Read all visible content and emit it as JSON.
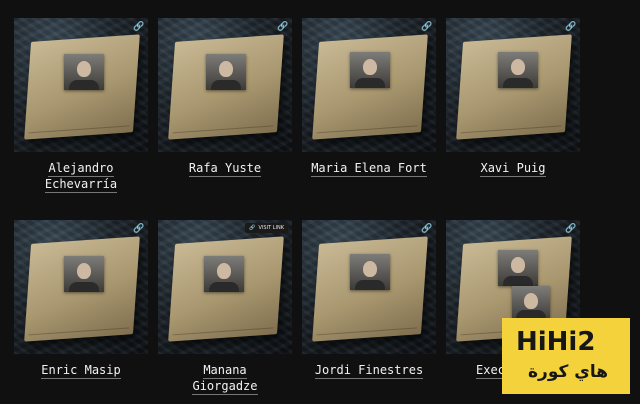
{
  "cards": [
    {
      "name_line1": "Alejandro",
      "name_line2": "Echevarría",
      "link_icon": "link-icon"
    },
    {
      "name_line1": "Rafa Yuste",
      "name_line2": "",
      "link_icon": "link-icon"
    },
    {
      "name_line1": "Maria Elena Fort",
      "name_line2": "",
      "link_icon": "link-icon"
    },
    {
      "name_line1": "Xavi Puig",
      "name_line2": "",
      "link_icon": "link-icon"
    },
    {
      "name_line1": "Enric Masip",
      "name_line2": "",
      "link_icon": "link-icon"
    },
    {
      "name_line1": "Manana",
      "name_line2": "Giorgadze",
      "visit_label": "VISIT LINK"
    },
    {
      "name_line1": "Jordi Finestres",
      "name_line2": "",
      "link_icon": "link-icon"
    },
    {
      "name_line1": "Exec",
      "name_line2": "",
      "link_icon": "link-icon"
    }
  ],
  "watermark": {
    "main": "HiHi2",
    "sub": "هاي كورة"
  }
}
